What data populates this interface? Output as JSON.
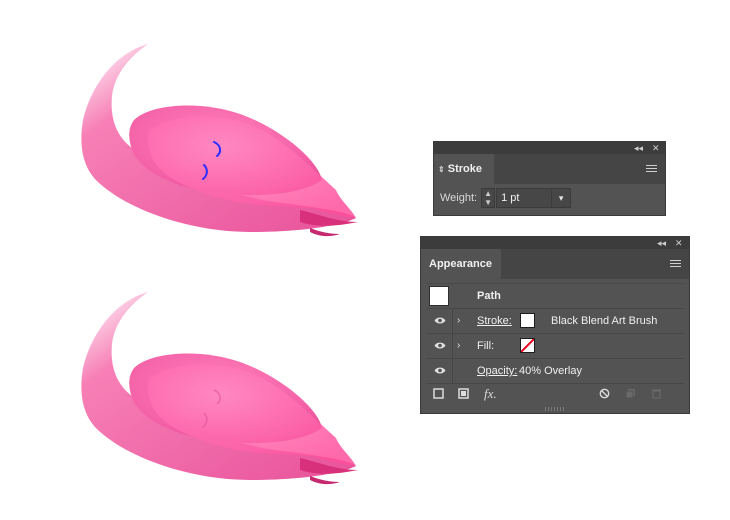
{
  "stroke_panel": {
    "tab_label": "Stroke",
    "weight_label": "Weight:",
    "weight_value": "1 pt"
  },
  "appearance_panel": {
    "tab_label": "Appearance",
    "path_label": "Path",
    "rows": [
      {
        "label": "Stroke:",
        "value": "Black Blend Art Brush"
      },
      {
        "label": "Fill:",
        "value": ""
      },
      {
        "label": "Opacity:",
        "value": "40% Overlay"
      }
    ]
  },
  "colors": {
    "flamingo_pink": "#ef5a9f",
    "flamingo_light": "#fbb6d2",
    "wing_pink": "#ff73b3",
    "panel_bg": "#535353",
    "header_bg": "#3c3c3c",
    "selection_blue": "#2e2cff"
  },
  "icons": [
    "collapse-icon",
    "close-icon",
    "panel-menu-icon",
    "stepper-icon",
    "dropdown-icon",
    "eye-icon",
    "expand-arrow-icon",
    "new-stroke-icon",
    "new-fill-icon",
    "fx-icon",
    "clear-icon",
    "duplicate-icon",
    "delete-icon"
  ]
}
